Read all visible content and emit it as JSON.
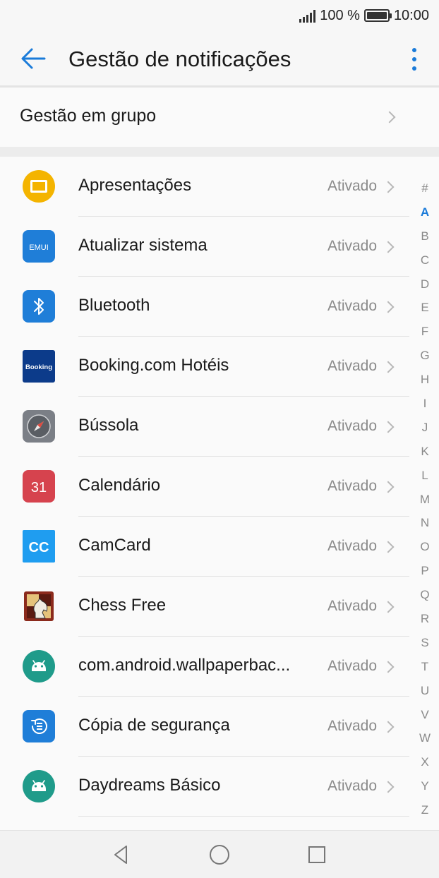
{
  "status_bar": {
    "battery_text": "100 %",
    "time": "10:00"
  },
  "header": {
    "title": "Gestão de notificações",
    "back_icon": "arrow-left-icon",
    "menu_icon": "more-vertical-icon"
  },
  "group": {
    "label": "Gestão em grupo"
  },
  "apps": [
    {
      "name": "Apresentações",
      "state": "Ativado",
      "icon": "slides-icon"
    },
    {
      "name": "Atualizar sistema",
      "state": "Ativado",
      "icon": "emui-icon",
      "icon_text": "EMUI"
    },
    {
      "name": "Bluetooth",
      "state": "Ativado",
      "icon": "bluetooth-icon"
    },
    {
      "name": "Booking.com Hotéis",
      "state": "Ativado",
      "icon": "booking-icon",
      "icon_text": "Booking"
    },
    {
      "name": "Bússola",
      "state": "Ativado",
      "icon": "compass-icon"
    },
    {
      "name": "Calendário",
      "state": "Ativado",
      "icon": "calendar-icon",
      "icon_text": "31"
    },
    {
      "name": "CamCard",
      "state": "Ativado",
      "icon": "camcard-icon",
      "icon_text": "CC"
    },
    {
      "name": "Chess Free",
      "state": "Ativado",
      "icon": "chess-icon"
    },
    {
      "name": "com.android.wallpaperbac...",
      "state": "Ativado",
      "icon": "android-icon"
    },
    {
      "name": "Cópia de segurança",
      "state": "Ativado",
      "icon": "backup-icon"
    },
    {
      "name": "Daydreams Básico",
      "state": "Ativado",
      "icon": "android-icon"
    }
  ],
  "alphabet": [
    "#",
    "A",
    "B",
    "C",
    "D",
    "E",
    "F",
    "G",
    "H",
    "I",
    "J",
    "K",
    "L",
    "M",
    "N",
    "O",
    "P",
    "Q",
    "R",
    "S",
    "T",
    "U",
    "V",
    "W",
    "X",
    "Y",
    "Z"
  ],
  "alphabet_active": "A",
  "nav": {
    "back_icon": "nav-back-triangle-icon",
    "home_icon": "nav-home-circle-icon",
    "recents_icon": "nav-recents-square-icon"
  },
  "colors": {
    "accent": "#1a7bd9",
    "muted_text": "#8a8a8a"
  }
}
